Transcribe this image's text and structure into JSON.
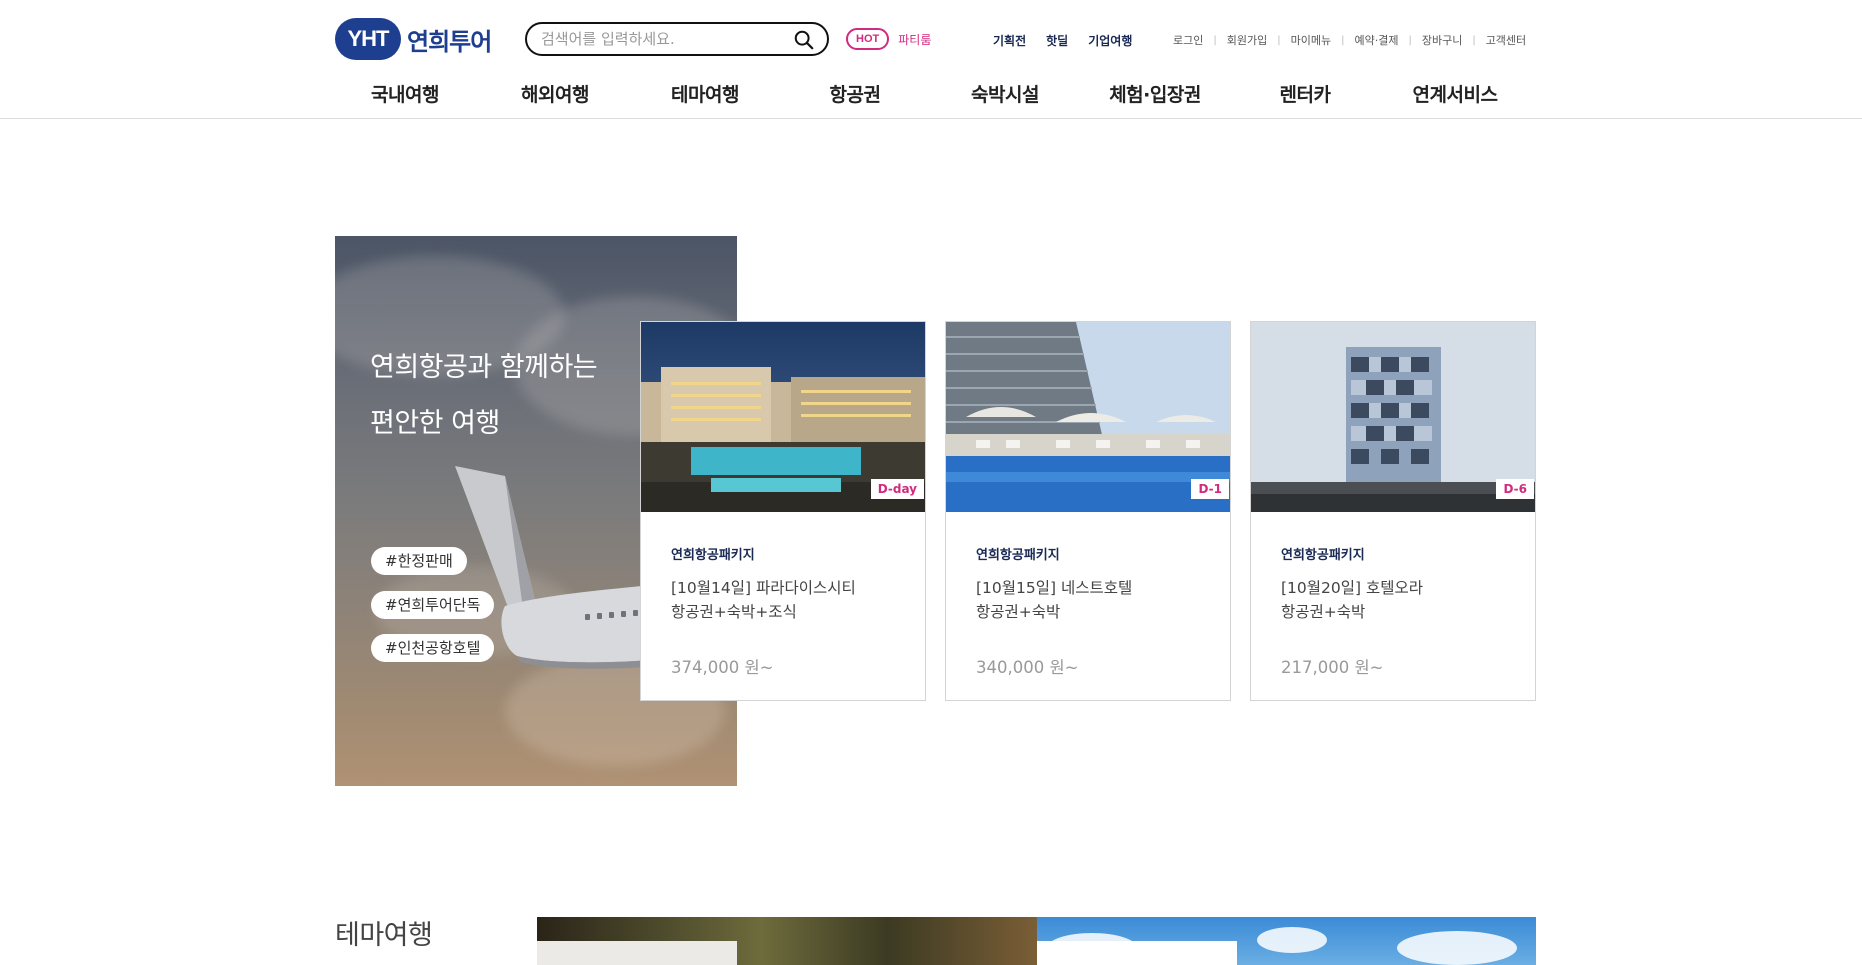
{
  "header": {
    "logo_badge": "YHT",
    "logo_text": "연희투어",
    "search_placeholder": "검색어를 입력하세요.",
    "hot_badge": "HOT",
    "hot_label": "파티룸",
    "quick_links": [
      "기획전",
      "핫딜",
      "기업여행"
    ],
    "util_links": [
      "로그인",
      "회원가입",
      "마이메뉴",
      "예약·결제",
      "장바구니",
      "고객센터"
    ],
    "util_separator": "|",
    "brand_color": "#1e3f8f",
    "accent_color": "#d12a7e"
  },
  "gnb": [
    "국내여행",
    "해외여행",
    "테마여행",
    "항공권",
    "숙박시설",
    "체험·입장권",
    "렌터카",
    "연계서비스"
  ],
  "promo": {
    "title_line1": "연희항공과 함께하는",
    "title_line2": "편안한 여행",
    "tags": [
      "#한정판매",
      "#연희투어단독",
      "#인천공항호텔"
    ]
  },
  "cards": [
    {
      "dday": "D-day",
      "category": "연희항공패키지",
      "title_line1": "[10월14일] 파라다이스시티",
      "title_line2": "항공권+숙박+조식",
      "price": "374,000 원~"
    },
    {
      "dday": "D-1",
      "category": "연희항공패키지",
      "title_line1": "[10월15일] 네스트호텔",
      "title_line2": "항공권+숙박",
      "price": "340,000 원~"
    },
    {
      "dday": "D-6",
      "category": "연희항공패키지",
      "title_line1": "[10월20일] 호텔오라",
      "title_line2": "항공권+숙박",
      "price": "217,000 원~"
    }
  ],
  "theme": {
    "title": "테마여행"
  }
}
